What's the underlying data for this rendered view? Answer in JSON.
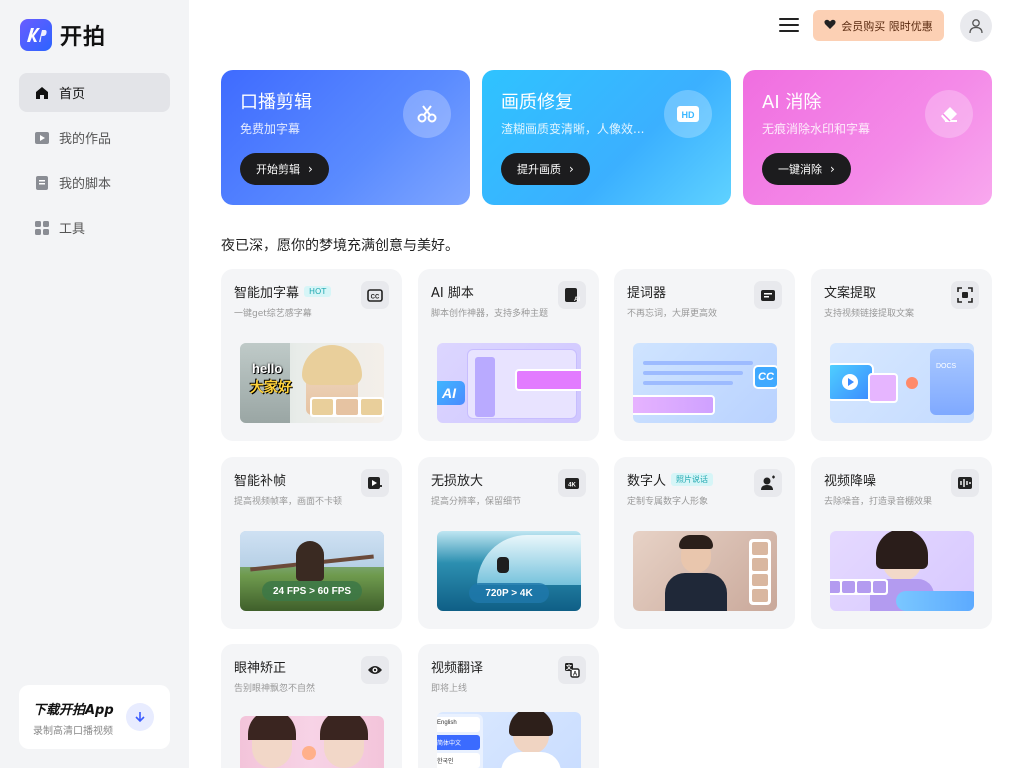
{
  "app": {
    "name": "开拍",
    "logo_mark": "kp"
  },
  "sidebar": {
    "items": [
      {
        "label": "首页",
        "icon": "home-icon",
        "active": true
      },
      {
        "label": "我的作品",
        "icon": "play-box-icon",
        "active": false
      },
      {
        "label": "我的脚本",
        "icon": "doc-icon",
        "active": false
      },
      {
        "label": "工具",
        "icon": "grid-icon",
        "active": false
      }
    ],
    "download": {
      "title": "下载开拍App",
      "subtitle": "录制高清口播视频"
    }
  },
  "header": {
    "vip_label": "会员购买 限时优惠"
  },
  "features": [
    {
      "title": "口播剪辑",
      "subtitle": "免费加字幕",
      "action": "开始剪辑",
      "icon": "scissors-icon"
    },
    {
      "title": "画质修复",
      "subtitle": "渣糊画质变清晰，人像效...",
      "action": "提升画质",
      "icon": "hd-icon"
    },
    {
      "title": "AI 消除",
      "subtitle": "无痕消除水印和字幕",
      "action": "一键消除",
      "icon": "eraser-icon"
    }
  ],
  "greeting": "夜已深，愿你的梦境充满创意与美好。",
  "tools": [
    {
      "name": "智能加字幕",
      "badge": "HOT",
      "desc": "一键get综艺感字幕",
      "icon": "cc-icon",
      "thumb_text": "hello 大家好"
    },
    {
      "name": "AI 脚本",
      "badge": "",
      "desc": "脚本创作神器，支持多种主题",
      "icon": "ai-script-icon",
      "thumb_text": "AI"
    },
    {
      "name": "提词器",
      "badge": "",
      "desc": "不再忘词，大屏更高效",
      "icon": "teleprompter-icon",
      "thumb_text": "CC"
    },
    {
      "name": "文案提取",
      "badge": "",
      "desc": "支持视频链接提取文案",
      "icon": "extract-icon",
      "thumb_text": "DOCS"
    },
    {
      "name": "智能补帧",
      "badge": "",
      "desc": "提高视频帧率，画面不卡顿",
      "icon": "frame-icon",
      "thumb_text": "24 FPS > 60 FPS"
    },
    {
      "name": "无损放大",
      "badge": "",
      "desc": "提高分辨率，保留细节",
      "icon": "4k-icon",
      "thumb_text": "720P > 4K"
    },
    {
      "name": "数字人",
      "badge": "照片说话",
      "desc": "定制专属数字人形象",
      "icon": "digital-human-icon",
      "thumb_text": ""
    },
    {
      "name": "视频降噪",
      "badge": "",
      "desc": "去除噪音，打造录音棚效果",
      "icon": "denoise-icon",
      "thumb_text": ""
    },
    {
      "name": "眼神矫正",
      "badge": "",
      "desc": "告别眼神飘忽不自然",
      "icon": "eye-icon",
      "thumb_text": ""
    },
    {
      "name": "视频翻译",
      "badge": "",
      "desc": "即将上线",
      "icon": "translate-icon",
      "thumb_text": ""
    }
  ],
  "translate_langs": [
    "English",
    "简体中文",
    "한국인"
  ],
  "colors": {
    "accent": "#3f6bff",
    "vip_bg": "#fcd0b4",
    "sidebar_bg": "#f3f4f6",
    "card_bg": "#f4f5f7"
  }
}
